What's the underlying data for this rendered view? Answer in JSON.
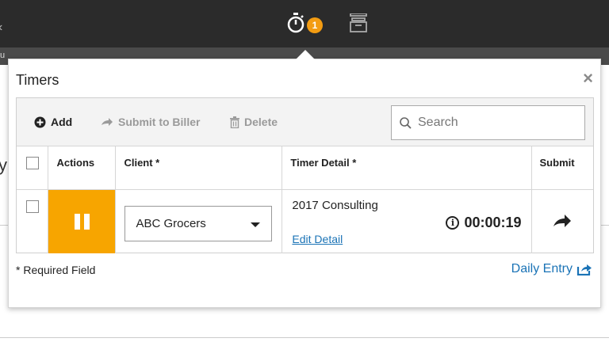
{
  "topbar": {
    "timer_badge_count": "1",
    "icons": [
      "stopwatch-icon",
      "archive-icon"
    ]
  },
  "popup": {
    "title": "Timers",
    "close_label": "×"
  },
  "toolbar": {
    "add_label": "Add",
    "submit_label": "Submit to Biller",
    "delete_label": "Delete",
    "search_placeholder": "Search",
    "search_value": ""
  },
  "table": {
    "headers": {
      "actions": "Actions",
      "client": "Client *",
      "timer_detail": "Timer Detail *",
      "submit": "Submit"
    },
    "rows": [
      {
        "client": "ABC Grocers",
        "detail": "2017 Consulting",
        "edit_link": "Edit Detail",
        "elapsed": "00:00:19"
      }
    ]
  },
  "footer": {
    "required_note": "* Required Field",
    "daily_entry_label": "Daily Entry"
  },
  "colors": {
    "accent_orange": "#f7a500",
    "link_blue": "#1a73b6",
    "badge_orange": "#f39c12",
    "topbar_bg": "#2b2b2b"
  }
}
